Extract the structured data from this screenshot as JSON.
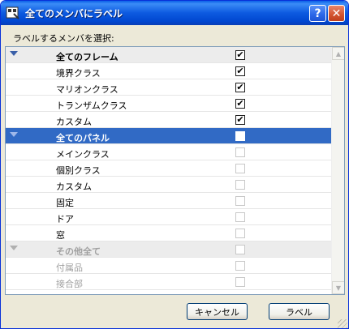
{
  "window": {
    "title": "全てのメンバにラベル",
    "help_label": "?",
    "close_label": "✕",
    "title_color": "#0054e3"
  },
  "prompt": "ラベルするメンバを選択:",
  "list": {
    "groups": [
      {
        "label": "全てのフレーム",
        "checked": true,
        "selected": false,
        "disabled": false,
        "items": [
          {
            "label": "境界クラス",
            "checked": true
          },
          {
            "label": "マリオンクラス",
            "checked": true
          },
          {
            "label": "トランザムクラス",
            "checked": true
          },
          {
            "label": "カスタム",
            "checked": true
          }
        ]
      },
      {
        "label": "全てのパネル",
        "checked": false,
        "selected": true,
        "disabled": false,
        "items": [
          {
            "label": "メインクラス",
            "checked": false
          },
          {
            "label": "個別クラス",
            "checked": false
          },
          {
            "label": "カスタム",
            "checked": false
          },
          {
            "label": "固定",
            "checked": false
          },
          {
            "label": "ドア",
            "checked": false
          },
          {
            "label": "窓",
            "checked": false
          }
        ]
      },
      {
        "label": "その他全て",
        "checked": false,
        "selected": false,
        "disabled": true,
        "items": [
          {
            "label": "付属品",
            "checked": false
          },
          {
            "label": "接合部",
            "checked": false
          }
        ]
      }
    ],
    "selection_color": "#316ac5"
  },
  "buttons": {
    "cancel": "キャンセル",
    "ok": "ラベル"
  }
}
